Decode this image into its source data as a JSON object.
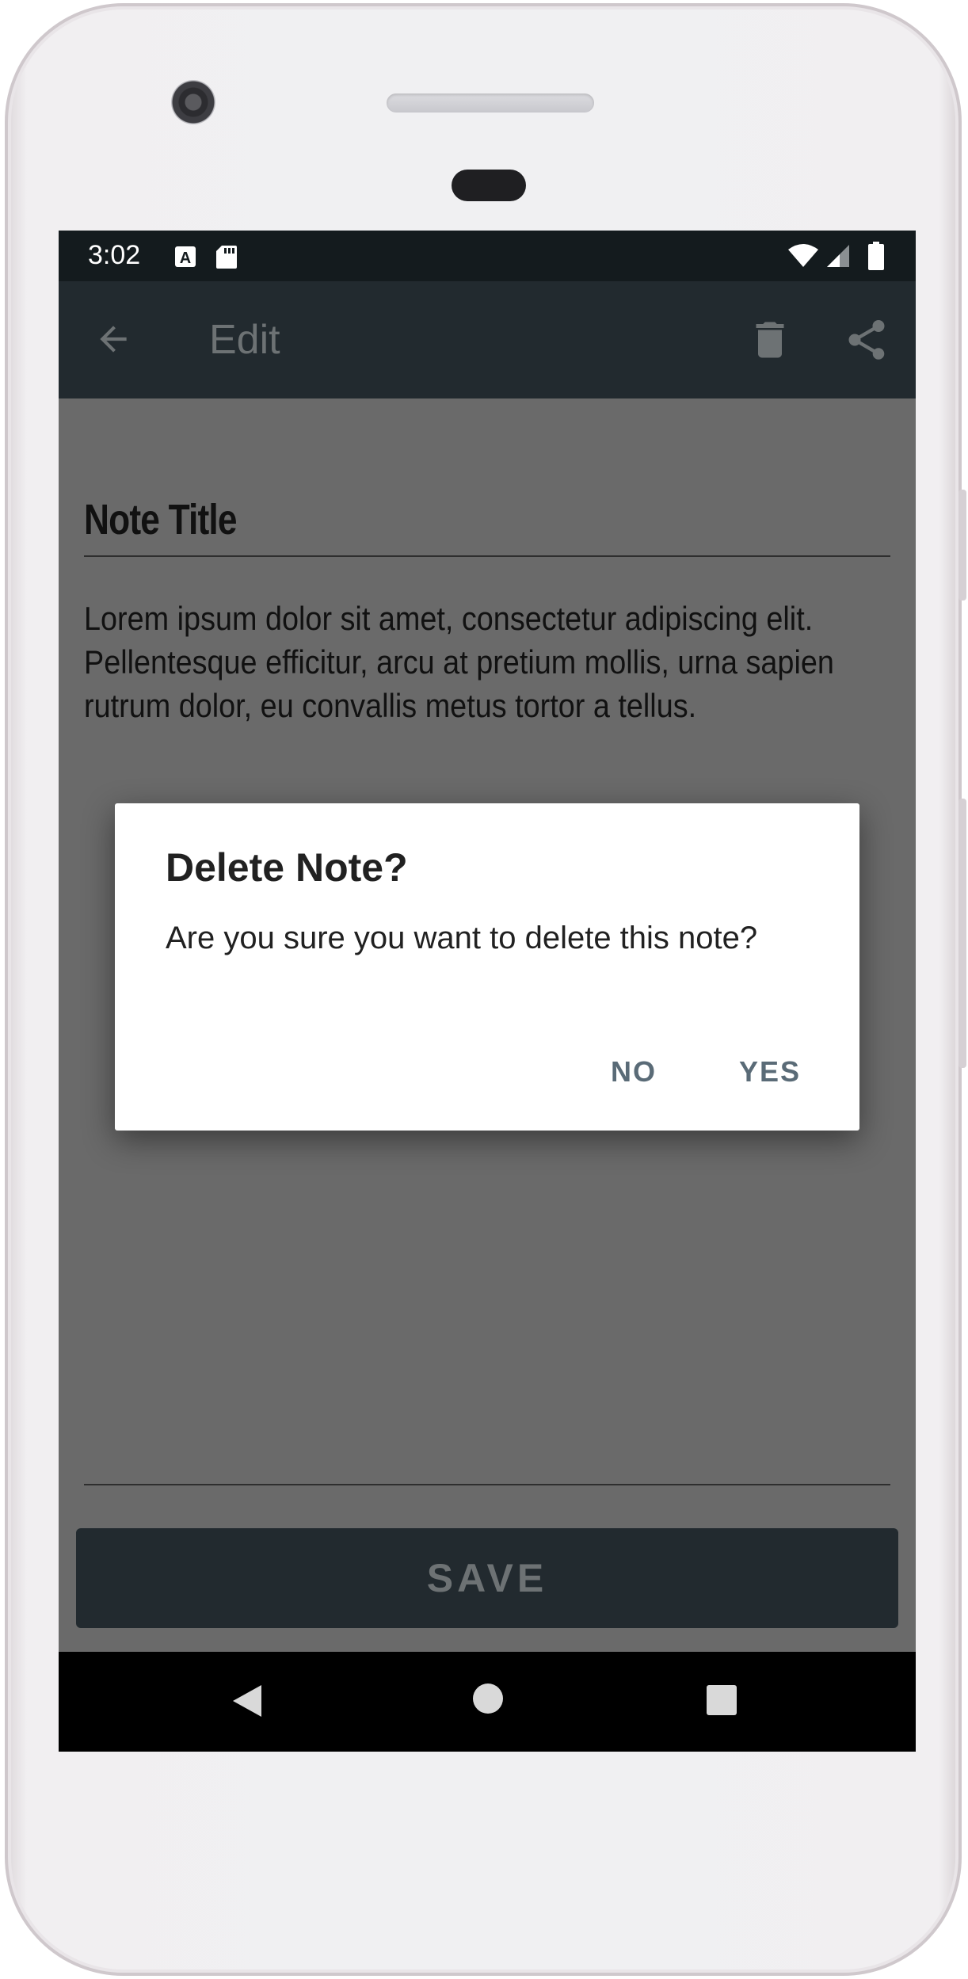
{
  "status_bar": {
    "time": "3:02"
  },
  "app_bar": {
    "title": "Edit"
  },
  "note": {
    "title": "Note Title",
    "body": "Lorem ipsum dolor sit amet, consectetur adipiscing elit. Pellentesque efficitur, arcu at pretium mollis, urna sapien rutrum dolor, eu convallis metus tortor a tellus."
  },
  "save_button": {
    "label": "SAVE"
  },
  "dialog": {
    "title": "Delete Note?",
    "message": "Are you sure you want to delete this note?",
    "no_label": "NO",
    "yes_label": "YES"
  },
  "colors": {
    "app_bar": "#222a2f",
    "scrim": "#6a6a6a",
    "dialog_button": "#5a6b77"
  }
}
